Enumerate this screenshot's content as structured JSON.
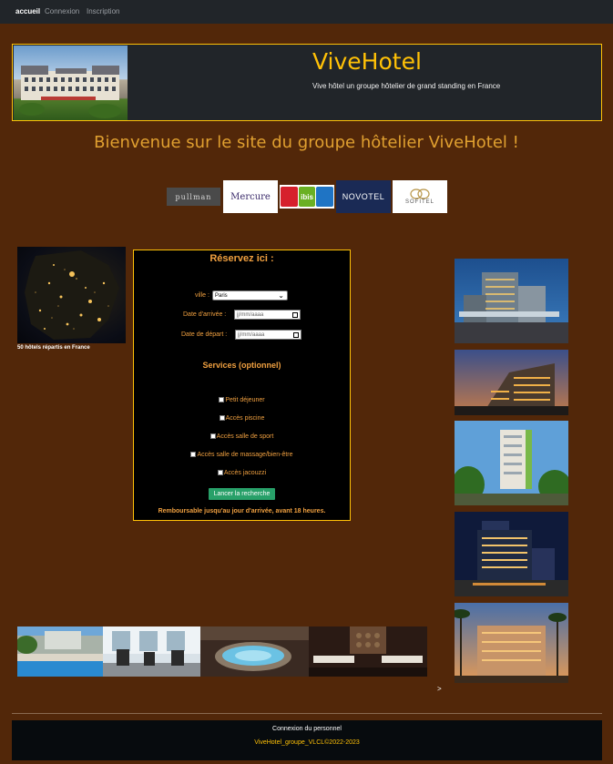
{
  "nav": {
    "items": [
      {
        "label": "accueil",
        "active": true
      },
      {
        "label": "Connexion",
        "active": false
      },
      {
        "label": "Inscription",
        "active": false
      }
    ]
  },
  "header": {
    "title": "ViveHotel",
    "subtitle": "Vive hôtel un groupe hôtelier de grand standing en France"
  },
  "welcome": "Bienvenue sur le site du groupe hôtelier ViveHotel !",
  "logos": {
    "pullman": "pullman",
    "mercure": "Mercure",
    "ibis": "ibis",
    "novotel": "NOVOTEL",
    "sofitel": "SOFITEL"
  },
  "france_caption": "50 hôtels répartis en France",
  "form": {
    "title": "Réservez ici :",
    "city_label": "ville :",
    "city_value": "Paris",
    "arrival_label": "Date d'arrivée :",
    "arrival_placeholder": "jj/mm/aaaa",
    "departure_label": "Date de départ :",
    "departure_placeholder": "jj/mm/aaaa",
    "services_title": "Services (optionnel)",
    "services": [
      "Petit déjeuner",
      "Accès piscine",
      "Accès salle de sport",
      "Accès salle de massage/bien-être",
      "Accès jacouzzi"
    ],
    "submit": "Lancer la recherche",
    "refund_note": "Remboursable jusqu'au jour d'arrivée, avant 18 heures."
  },
  "carousel_next": ">",
  "footer": {
    "staff_link": "Connexion du personnel",
    "copyright": "VivеHotel_groupe_VLCL©2022-2023"
  },
  "colors": {
    "background": "#522709",
    "accent": "#ffc107",
    "form_text": "#f0a040",
    "button": "#28a069"
  }
}
